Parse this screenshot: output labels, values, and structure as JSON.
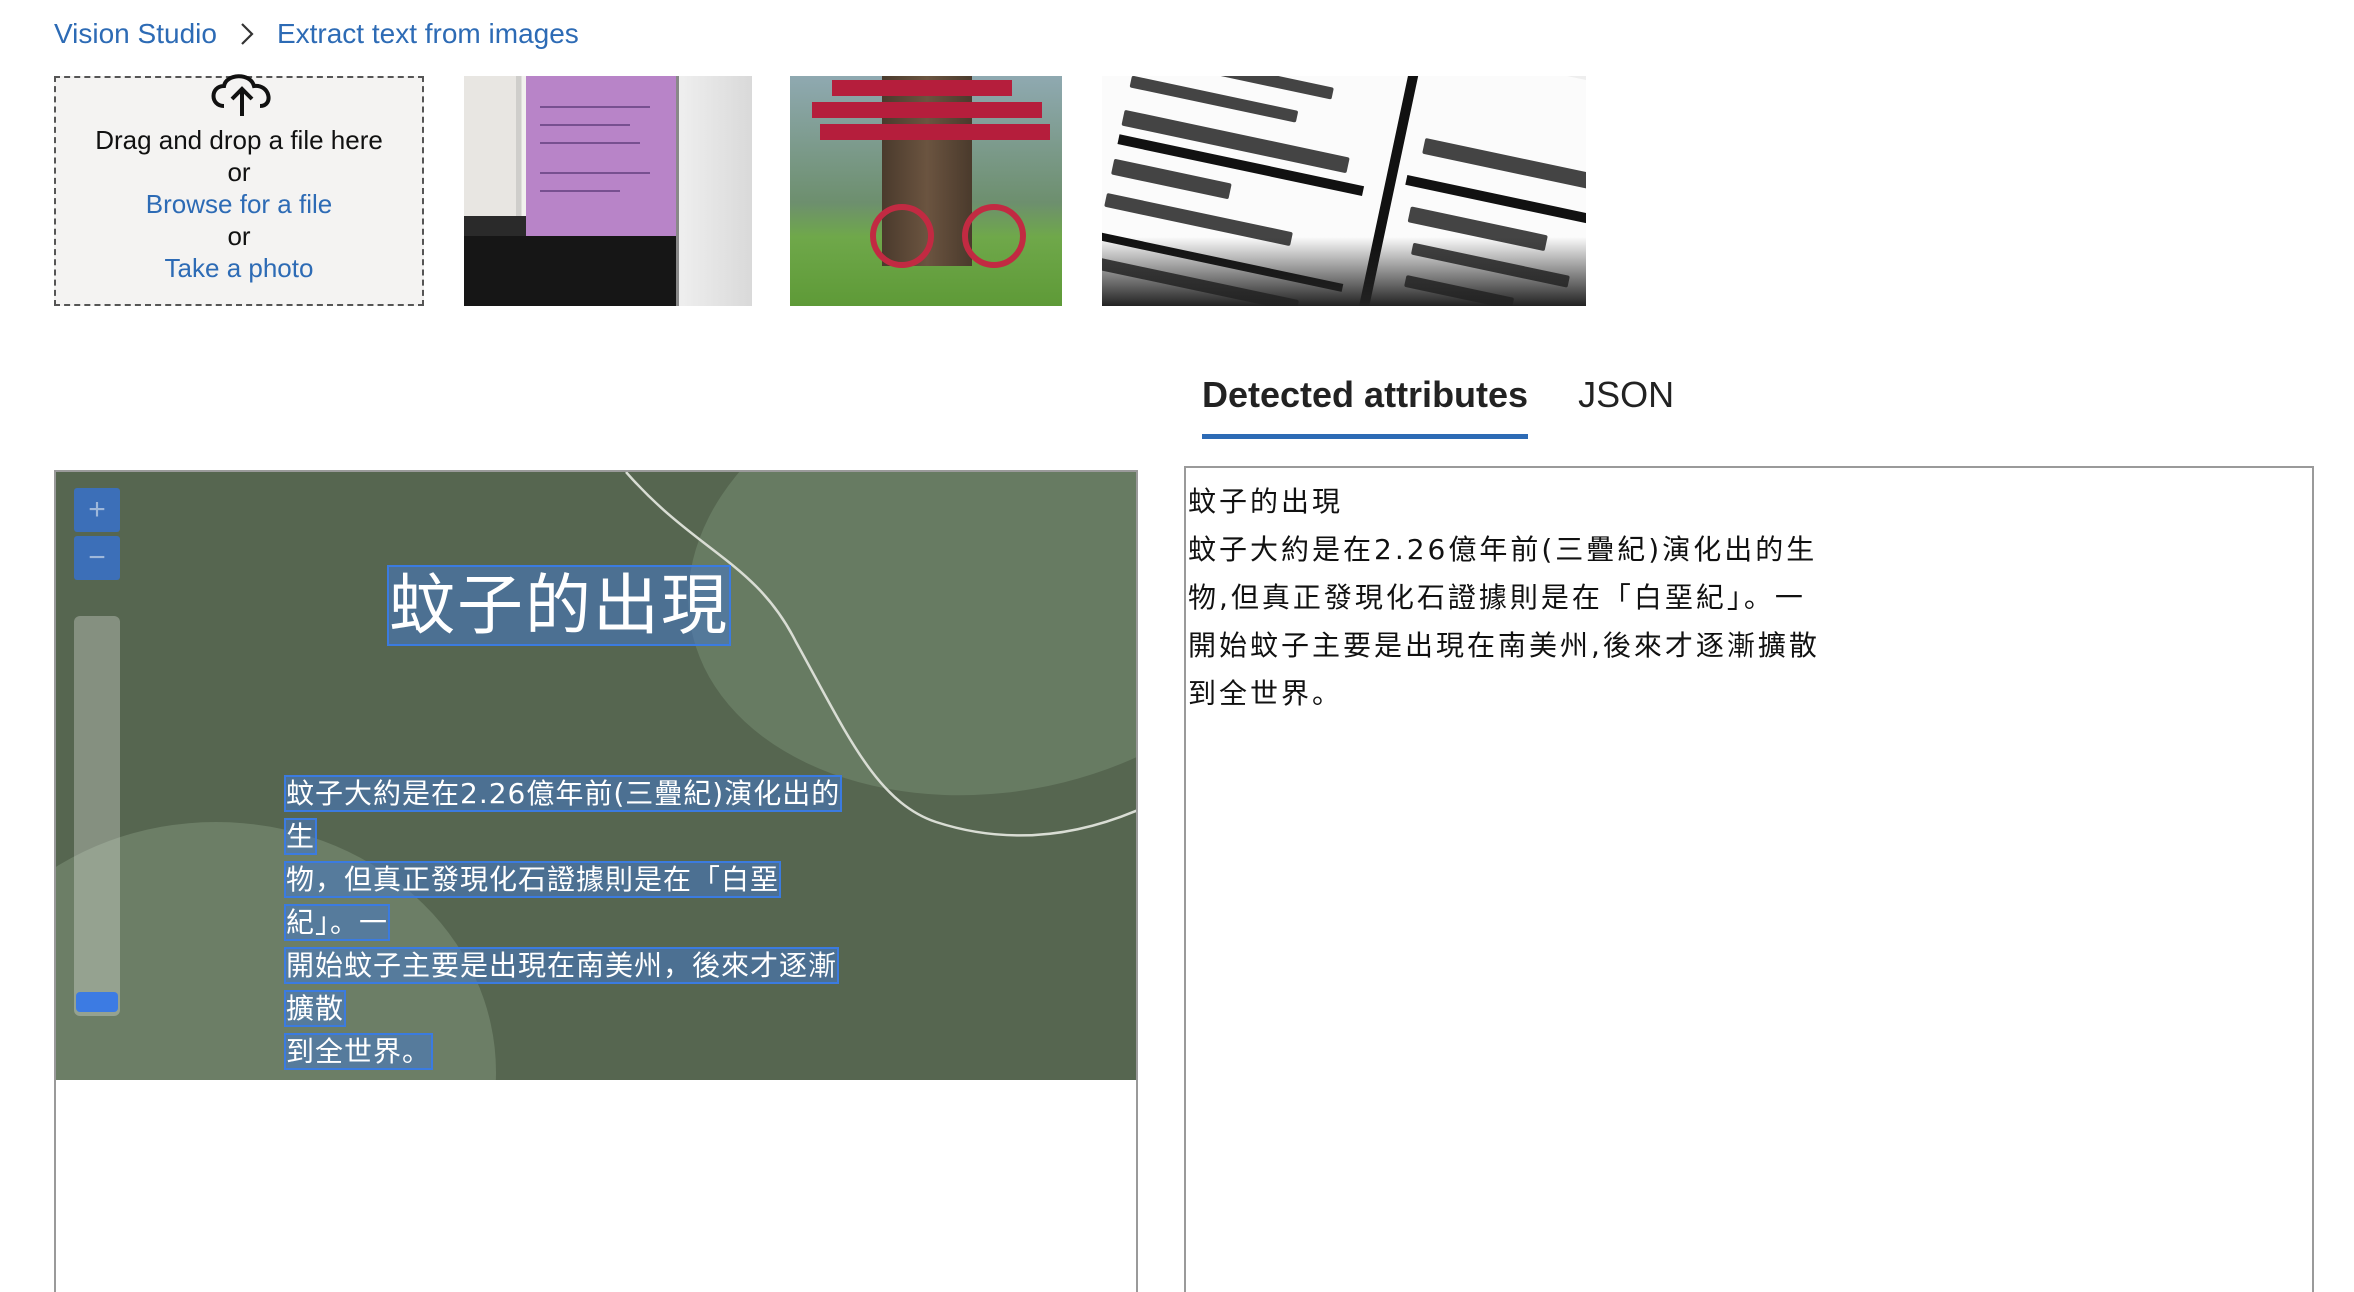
{
  "breadcrumb": {
    "root": "Vision Studio",
    "current": "Extract text from images"
  },
  "upload": {
    "drag_text": "Drag and drop a file here",
    "or1": "or",
    "browse": "Browse for a file",
    "or2": "or",
    "photo": "Take a photo"
  },
  "tabs": {
    "detected": "Detected attributes",
    "json": "JSON"
  },
  "viewer": {
    "zoom_in": "+",
    "zoom_out": "−",
    "title": "蚊子的出現",
    "body_lines": [
      "蚊子大約是在2.26億年前(三疊紀)演化出的生",
      "物，但真正發現化石證據則是在「白堊紀」。一",
      "開始蚊子主要是出現在南美州，後來才逐漸擴散",
      "到全世界。"
    ],
    "zoom_level": 0
  },
  "result": {
    "lines": [
      "蚊子的出現",
      "蚊子大約是在2.26億年前(三疊紀)演化出的生",
      "物,但真正發現化石證據則是在「白堊紀」。一",
      "開始蚊子主要是出現在南美州,後來才逐漸擴散",
      "到全世界。"
    ]
  },
  "icons": {
    "upload": "cloud-upload-icon",
    "separator": "chevron-right-icon"
  },
  "colors": {
    "accent": "#2d6bb5",
    "ocr_box": "#3b7be0",
    "canvas_bg": "#566650"
  }
}
